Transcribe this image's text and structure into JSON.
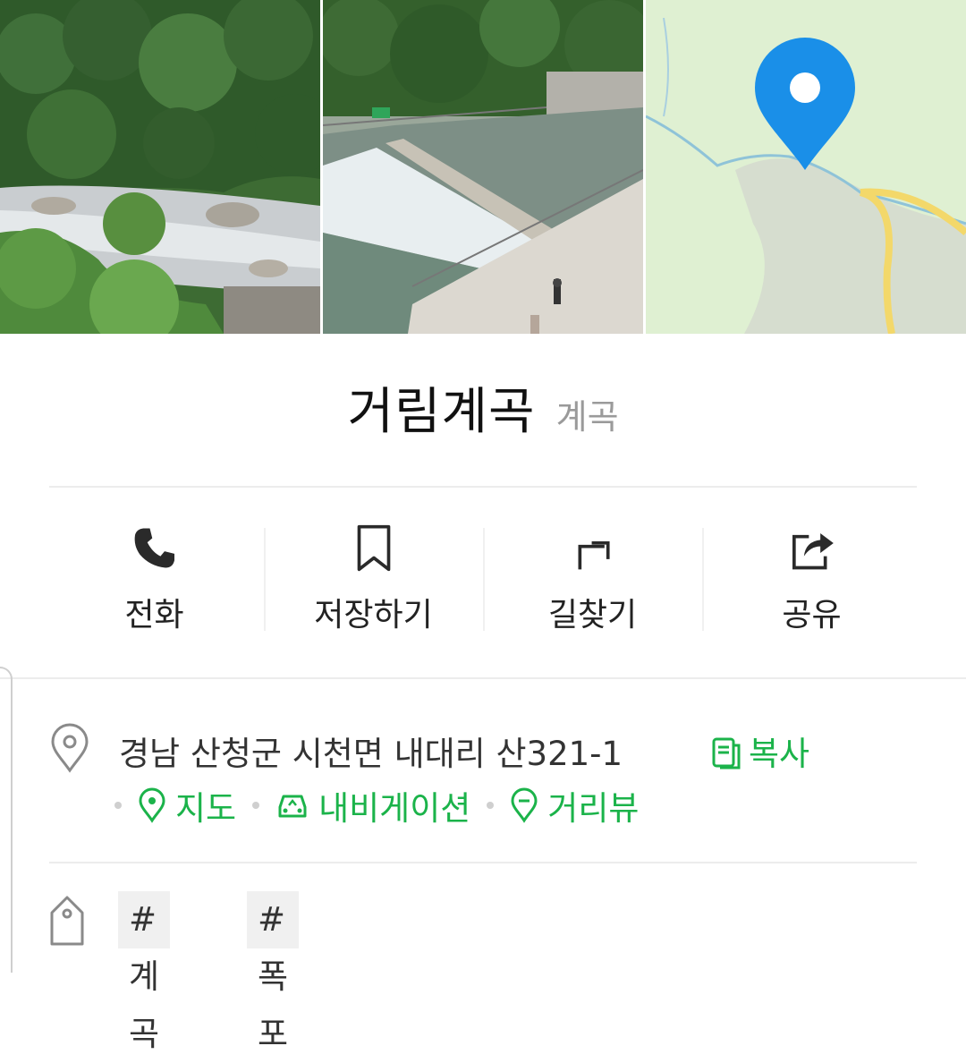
{
  "place": {
    "name": "거림계곡",
    "category": "계곡"
  },
  "gallery": {
    "photos": [
      {
        "icon": "valley-stream-photo"
      },
      {
        "icon": "weir-pool-photo"
      },
      {
        "icon": "map-thumbnail"
      }
    ]
  },
  "actions": [
    {
      "label": "전화",
      "icon": "phone-icon"
    },
    {
      "label": "저장하기",
      "icon": "bookmark-icon"
    },
    {
      "label": "길찾기",
      "icon": "directions-icon"
    },
    {
      "label": "공유",
      "icon": "share-icon"
    }
  ],
  "address": {
    "text": "경남 산청군 시천면 내대리 산321-1",
    "copy_label": "복사",
    "links": [
      {
        "label": "지도",
        "icon": "map-pin-icon"
      },
      {
        "label": "내비게이션",
        "icon": "car-icon"
      },
      {
        "label": "거리뷰",
        "icon": "streetview-icon"
      }
    ]
  },
  "tags": [
    "#계곡",
    "#폭포"
  ],
  "colors": {
    "accent_green": "#1bb34a",
    "map_pin_blue": "#1a8fe8",
    "map_bg": "#dff0d2"
  }
}
